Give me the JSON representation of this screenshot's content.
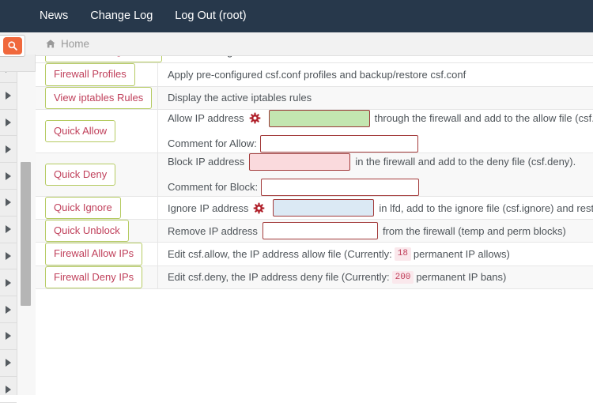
{
  "navbar": {
    "links": [
      {
        "label": "News",
        "name": "nav-news"
      },
      {
        "label": "Change Log",
        "name": "nav-change-log"
      },
      {
        "label": "Log Out (root)",
        "name": "nav-log-out"
      }
    ],
    "background": "#27384b"
  },
  "search": {
    "icon": "search-icon",
    "accent": "#f0683c"
  },
  "breadcrumb": {
    "icon": "home-icon",
    "label": "Home"
  },
  "sidebar": {
    "arrow_icon": "caret-right-icon",
    "scroll_up_icon": "caret-up-icon",
    "item_count": 13
  },
  "table": {
    "rows": [
      {
        "id": "firewall-configuration",
        "button": "Firewall Configuration",
        "desc": "Edit the configuration file for the csf firewall and lfd",
        "alt": false
      },
      {
        "id": "firewall-profiles",
        "button": "Firewall Profiles",
        "desc": "Apply pre-configured csf.conf profiles and backup/restore csf.conf",
        "alt": false
      },
      {
        "id": "view-iptables-rules",
        "button": "View iptables Rules",
        "desc": "Display the active iptables rules",
        "alt": true
      },
      {
        "id": "quick-allow",
        "button": "Quick Allow",
        "alt": false,
        "line1_pre": "Allow IP address",
        "line1_gear": true,
        "line1_post": "through the firewall and add to the allow file (csf.allow).",
        "line1_value": "",
        "line2_label": "Comment for Allow:",
        "line2_value": ""
      },
      {
        "id": "quick-deny",
        "button": "Quick Deny",
        "alt": true,
        "line1_pre": "Block IP address",
        "line1_gear": false,
        "line1_post": "in the firewall and add to the deny file (csf.deny).",
        "line1_value": "",
        "line2_label": "Comment for Block:",
        "line2_value": ""
      },
      {
        "id": "quick-ignore",
        "button": "Quick Ignore",
        "alt": false,
        "line1_pre": "Ignore IP address",
        "line1_gear": true,
        "line1_post": "in lfd, add to the ignore file (csf.ignore) and restart lfd",
        "line1_value": ""
      },
      {
        "id": "quick-unblock",
        "button": "Quick Unblock",
        "alt": true,
        "line1_pre": "Remove IP address",
        "line1_gear": false,
        "line1_post": "from the firewall (temp and perm blocks)",
        "line1_value": ""
      },
      {
        "id": "firewall-allow-ips",
        "button": "Firewall Allow IPs",
        "alt": false,
        "desc_pre": "Edit csf.allow, the IP address allow file (Currently:",
        "badge": "18",
        "desc_post": "permanent IP allows)"
      },
      {
        "id": "firewall-deny-ips",
        "button": "Firewall Deny IPs",
        "alt": true,
        "desc_pre": "Edit csf.deny, the IP address deny file (Currently:",
        "badge": "200",
        "desc_post": "permanent IP bans)"
      }
    ]
  },
  "colors": {
    "button_border": "#b5cb61",
    "button_text": "#c0405b",
    "input_border": "#a33b3b",
    "allow_input_bg": "#c3e6b0",
    "deny_input_bg": "#fadadd",
    "ignore_input_bg": "#dbe9f4",
    "badge_bg": "#fae8ec"
  }
}
